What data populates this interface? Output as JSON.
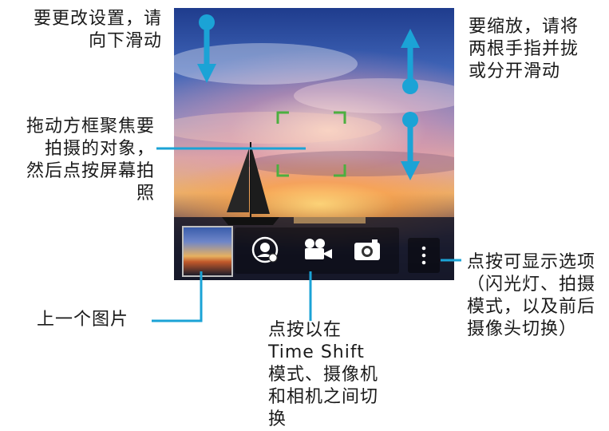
{
  "annotations": {
    "swipe_down_settings": "要更改设置，请\n向下滑动",
    "zoom": "要缩放，请将\n两根手指并拢\n或分开滑动",
    "focus": "拖动方框聚焦要\n拍摄的对象，\n然后点按屏幕拍\n照",
    "options": "点按可显示选项\n（闪光灯、拍摄\n模式，以及前后\n摄像头切换）",
    "previous_picture": "上一个图片",
    "mode_switch": "点按以在\nTime Shift\n模式、摄像机\n和相机之间切\n换"
  },
  "colors": {
    "callout": "#1ba3d6",
    "focus_frame": "#4caf3f",
    "page_bg": "#ffffff",
    "text": "#1a1a1a"
  },
  "icons": {
    "time_shift": "time-shift-icon",
    "video": "video-camera-icon",
    "camera": "camera-icon",
    "more": "more-vertical-icon"
  }
}
